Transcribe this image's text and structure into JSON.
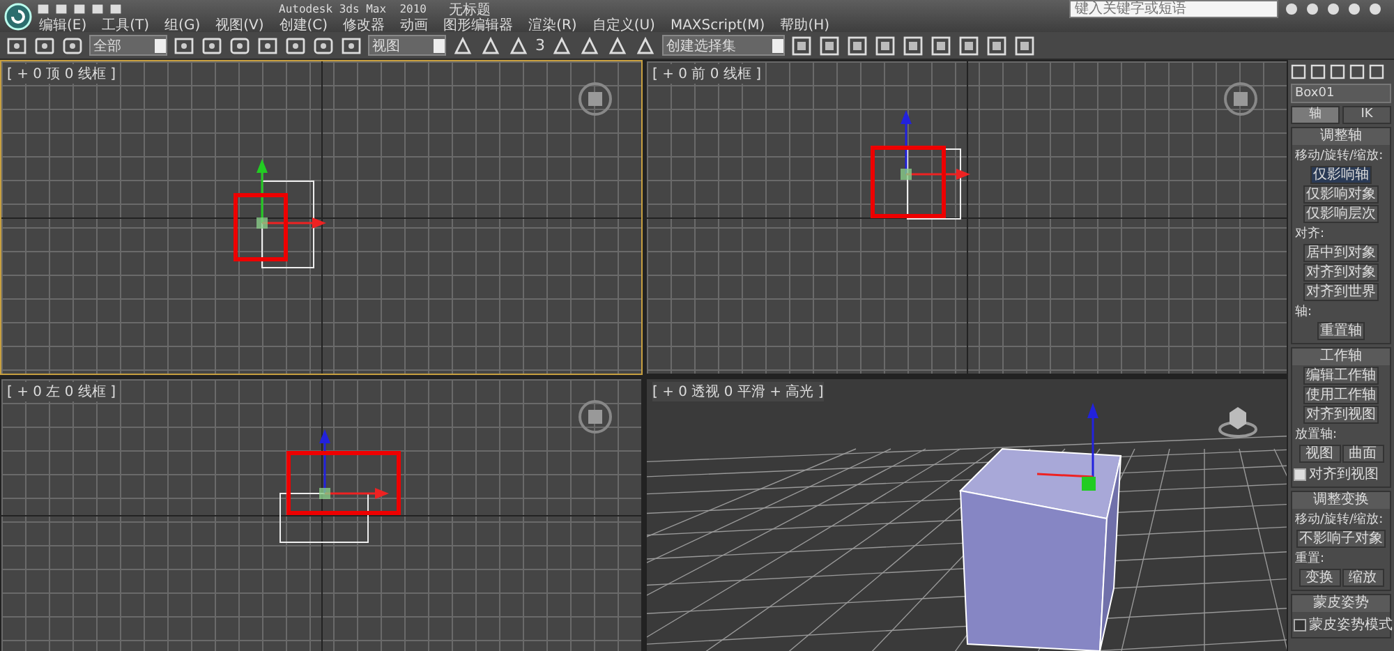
{
  "title_bar": {
    "app_title": "Autodesk 3ds Max  2010",
    "document_title": "无标题",
    "search": {
      "placeholder": "键入关键字或短语"
    }
  },
  "menu": [
    "编辑(E)",
    "工具(T)",
    "组(G)",
    "视图(V)",
    "创建(C)",
    "修改器",
    "动画",
    "图形编辑器",
    "渲染(R)",
    "自定义(U)",
    "MAXScript(M)",
    "帮助(H)"
  ],
  "toolbar": {
    "selection_filter": "全部",
    "reference_coordinate": "视图",
    "named_selection": "创建选择集",
    "snap_label": "3"
  },
  "viewports": [
    {
      "label": "[ + 0 顶 0 线框 ]",
      "kind": "ortho",
      "active": true
    },
    {
      "label": "[ + 0 前 0 线框 ]",
      "kind": "ortho",
      "active": false
    },
    {
      "label": "[ + 0 左 0 线框 ]",
      "kind": "ortho",
      "active": false
    },
    {
      "label": "[ + 0 透视 0 平滑 + 高光 ]",
      "kind": "perspective",
      "active": false
    }
  ],
  "command_panel": {
    "object_name": "Box01",
    "tabs": [
      {
        "label": "轴",
        "selected": true
      },
      {
        "label": "IK",
        "selected": false
      }
    ],
    "rollouts": [
      {
        "title": "调整轴",
        "groups": [
          {
            "label": "移动/旋转/缩放:",
            "buttons": [
              {
                "label": "仅影响轴",
                "selected": true
              },
              {
                "label": "仅影响对象",
                "selected": false
              },
              {
                "label": "仅影响层次",
                "selected": false
              }
            ]
          },
          {
            "label": "对齐:",
            "buttons": [
              {
                "label": "居中到对象",
                "selected": false
              },
              {
                "label": "对齐到对象",
                "selected": false
              },
              {
                "label": "对齐到世界",
                "selected": false
              }
            ]
          },
          {
            "label": "轴:",
            "buttons": [
              {
                "label": "重置轴",
                "selected": false
              }
            ]
          }
        ]
      },
      {
        "title": "工作轴",
        "groups": [
          {
            "buttons": [
              {
                "label": "编辑工作轴",
                "selected": false
              },
              {
                "label": "使用工作轴",
                "selected": false
              },
              {
                "label": "对齐到视图",
                "selected": false
              }
            ]
          },
          {
            "label": "放置轴:",
            "buttons": [
              {
                "label": "视图",
                "selected": false
              },
              {
                "label": "曲面",
                "selected": false
              }
            ],
            "checkbox": {
              "label": "对齐到视图",
              "checked": true
            }
          }
        ]
      },
      {
        "title": "调整变换",
        "groups": [
          {
            "label": "移动/旋转/缩放:",
            "buttons": [
              {
                "label": "不影响子对象",
                "selected": false
              }
            ]
          },
          {
            "label": "重置:",
            "buttons": [
              {
                "label": "变换",
                "selected": false
              },
              {
                "label": "缩放",
                "selected": false
              }
            ]
          }
        ]
      },
      {
        "title": "蒙皮姿势",
        "groups": [
          {
            "checkbox": {
              "label": "蒙皮姿势模式",
              "checked": false
            }
          }
        ]
      }
    ]
  }
}
